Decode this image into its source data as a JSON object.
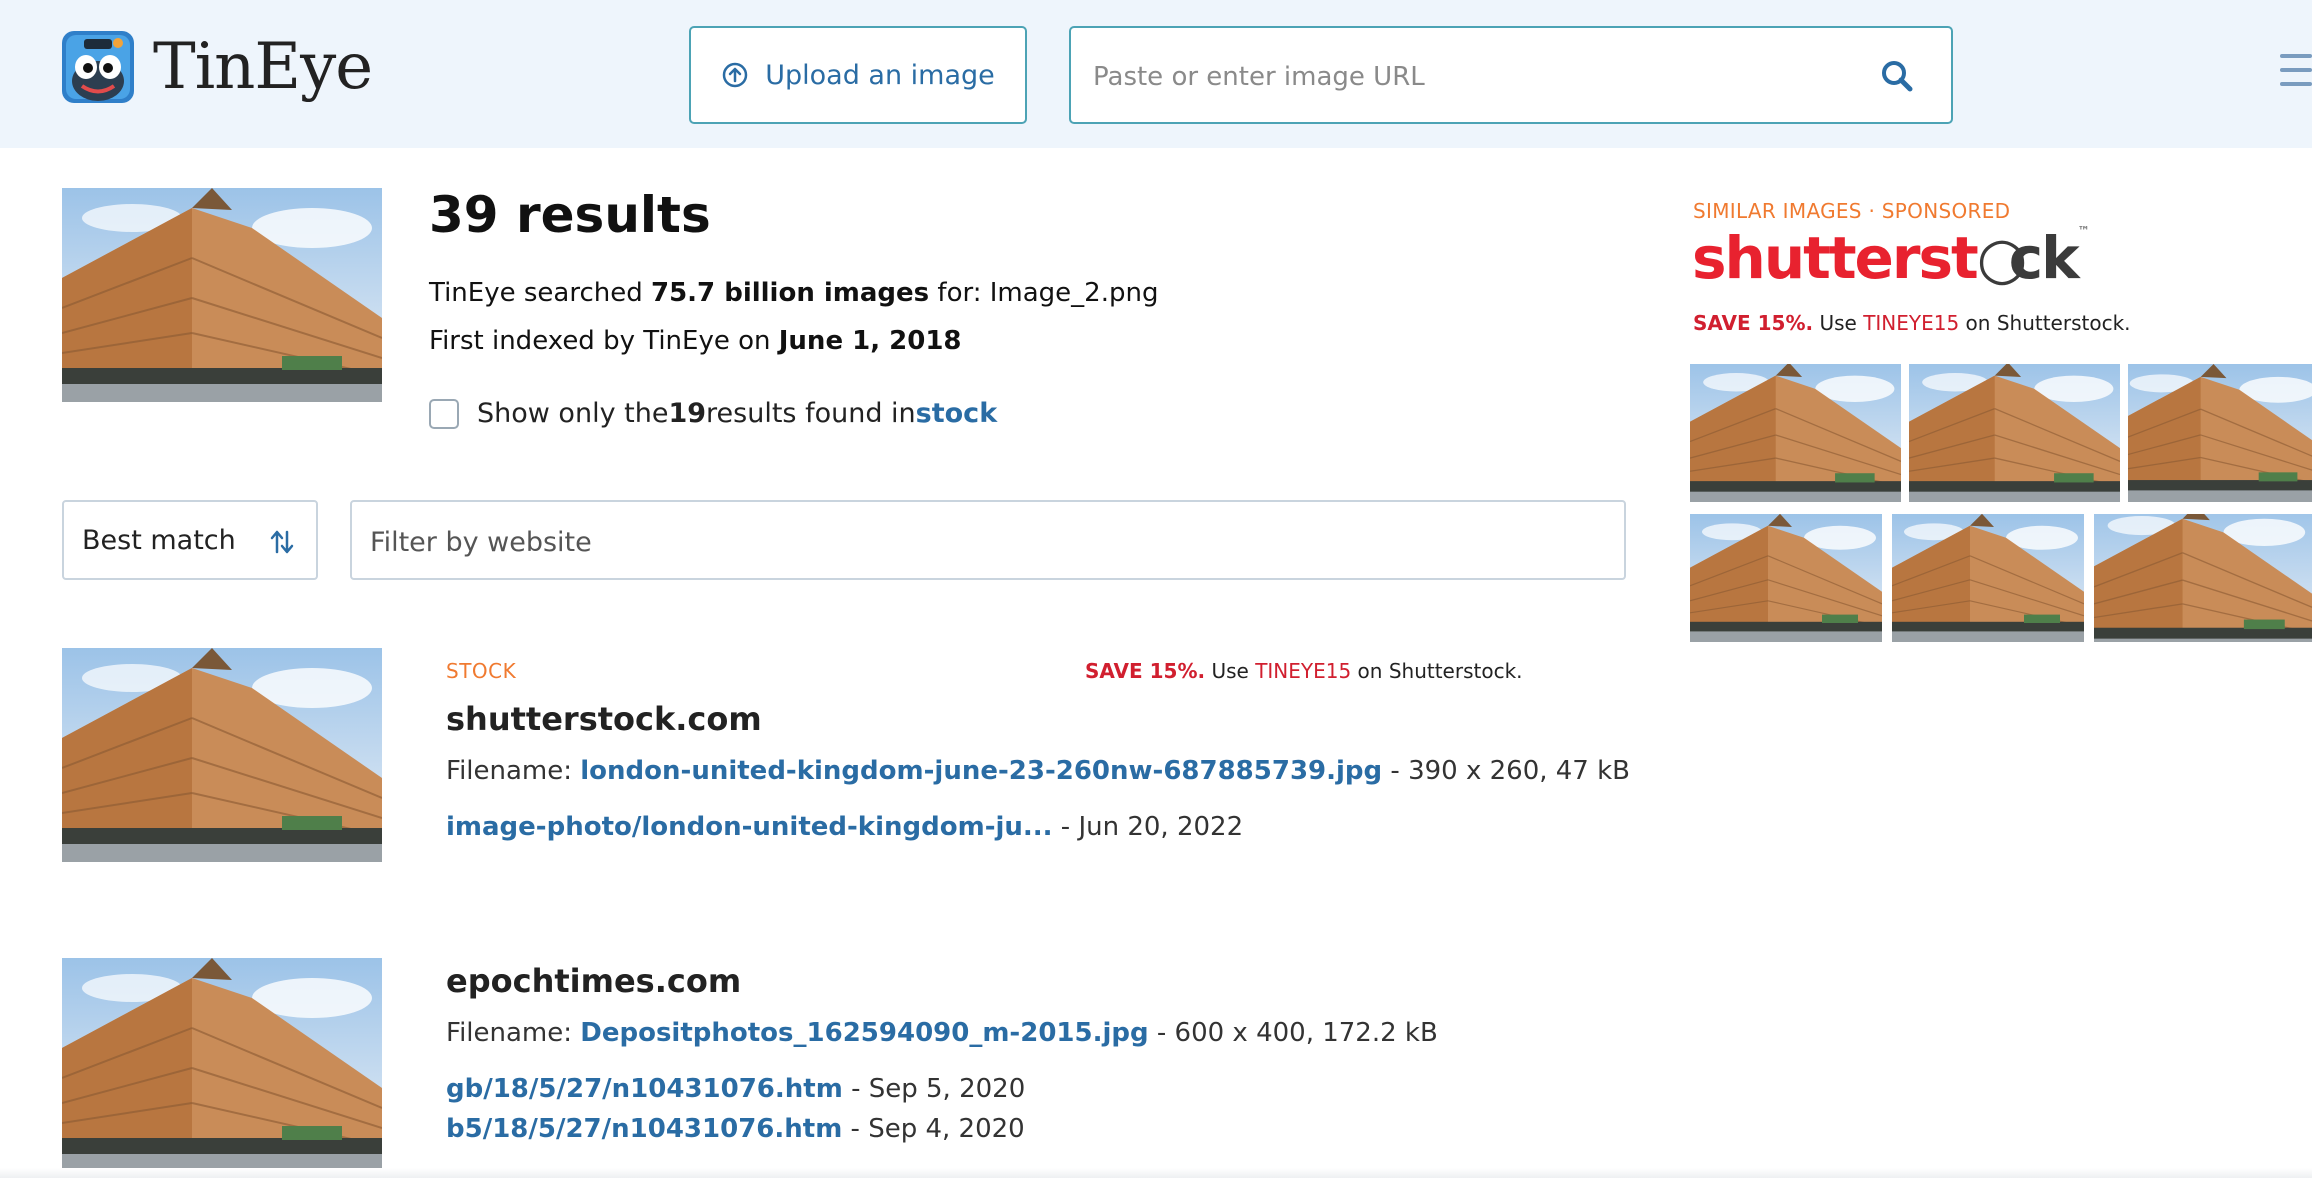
{
  "header": {
    "brand": "TinEye",
    "upload_label": "Upload an image",
    "url_placeholder": "Paste or enter image URL"
  },
  "summary": {
    "result_count": "39 results",
    "searched_prefix": "TinEye searched ",
    "searched_count": "75.7 billion images",
    "searched_for": " for: ",
    "query_filename": "Image_2.png",
    "indexed_prefix": "First indexed by TinEye on ",
    "indexed_date": "June 1, 2018",
    "stock_prefix": "Show only the ",
    "stock_count": "19",
    "stock_mid": " results found in ",
    "stock_link": "stock"
  },
  "controls": {
    "sort_value": "Best match",
    "filter_placeholder": "Filter by website"
  },
  "results": [
    {
      "tag": "STOCK",
      "promo_save": "SAVE 15%.",
      "promo_use": " Use ",
      "promo_code": "TINEYE15",
      "promo_suffix": " on Shutterstock.",
      "site": "shutterstock.com",
      "filename_label": "Filename: ",
      "filename": "london-united-kingdom-june-23-260nw-687885739.jpg",
      "file_info": " - 390 x 260, 47 kB",
      "links": [
        {
          "path": "image-photo/london-united-kingdom-ju...",
          "date": "  - Jun 20, 2022"
        }
      ]
    },
    {
      "site": "epochtimes.com",
      "filename_label": "Filename: ",
      "filename": "Depositphotos_162594090_m-2015.jpg",
      "file_info": " - 600 x 400, 172.2 kB",
      "links": [
        {
          "path": "gb/18/5/27/n10431076.htm",
          "date": " - Sep 5, 2020"
        },
        {
          "path": "b5/18/5/27/n10431076.htm",
          "date": " - Sep 4, 2020"
        }
      ]
    }
  ],
  "similar": {
    "label_left": "SIMILAR IMAGES",
    "label_dot": "  ·  ",
    "label_right": "SPONSORED",
    "logo_a": "shutterst",
    "logo_b": "ck",
    "logo_tm": "™",
    "promo_save": "SAVE 15%.",
    "promo_use": " Use ",
    "promo_code": "TINEYE15",
    "promo_suffix": " on Shutterstock."
  },
  "colors": {
    "accent": "#2a6ca4",
    "header_bg": "#eef5fc",
    "stock_orange": "#f07a30",
    "promo_red": "#d11f2f"
  },
  "icons": [
    "upload-icon",
    "search-icon",
    "menu-icon",
    "sort-icon",
    "tineye-logo-icon"
  ]
}
